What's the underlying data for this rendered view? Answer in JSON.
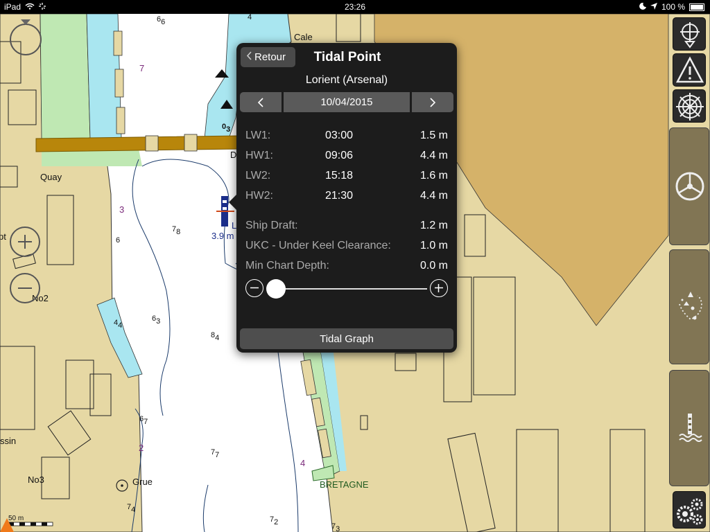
{
  "status_bar": {
    "device": "iPad",
    "time": "23:26",
    "battery": "100 %"
  },
  "map_labels": {
    "cale": "Cale",
    "quay": "Quay",
    "no2": "No2",
    "no3": "No3",
    "grue": "Grue",
    "bretagne": "BRETAGNE",
    "ssin": "ssin",
    "pt": "pt",
    "marker_prefix": "L",
    "marker_depth": "3.9 m",
    "scale": "50 m",
    "d_label": "D"
  },
  "depth_soundings": {
    "s66": "6",
    "s66sub": "6",
    "s4": "4",
    "s7": "7",
    "s03": "0",
    "s03sub": "3",
    "s3": "3",
    "s78": "7",
    "s78sub": "8",
    "s6": "6",
    "s44": "4",
    "s44sub": "4",
    "s63": "6",
    "s63sub": "3",
    "s84": "8",
    "s84sub": "4",
    "s67": "6",
    "s67sub": "7",
    "s2": "2",
    "s77": "7",
    "s77sub": "7",
    "s4b": "4",
    "s74": "7",
    "s74sub": "4",
    "s72": "7",
    "s72sub": "2",
    "s73": "7",
    "s73sub": "3"
  },
  "popup": {
    "back_label": "Retour",
    "title": "Tidal Point",
    "location": "Lorient (Arsenal)",
    "date": "10/04/2015",
    "tides": [
      {
        "label": "LW1:",
        "time": "03:00",
        "height": "1.5 m"
      },
      {
        "label": "HW1:",
        "time": "09:06",
        "height": "4.4 m"
      },
      {
        "label": "LW2:",
        "time": "15:18",
        "height": "1.6 m"
      },
      {
        "label": "HW2:",
        "time": "21:30",
        "height": "4.4 m"
      }
    ],
    "info": [
      {
        "label": "Ship Draft:",
        "value": "1.2 m"
      },
      {
        "label": "UKC - Under Keel Clearance:",
        "value": "1.0 m"
      },
      {
        "label": "Min Chart Depth:",
        "value": "0.0 m"
      }
    ],
    "slider_level": 0.0,
    "graph_button": "Tidal Graph"
  },
  "colors": {
    "land": "#e6d8a4",
    "land_dark": "#d5b269",
    "water": "#ffffff",
    "shallow": "#a9e6f0",
    "drying": "#bfe8b3",
    "popup_bg": "#1c1c1c"
  },
  "icons": {
    "compass": "compass-icon",
    "gps": "gps-icon",
    "warning": "warning-icon",
    "helm_small": "helm-icon",
    "helm_large": "helm-icon",
    "route": "route-icon",
    "tide": "tide-icon",
    "settings": "gears-icon"
  }
}
